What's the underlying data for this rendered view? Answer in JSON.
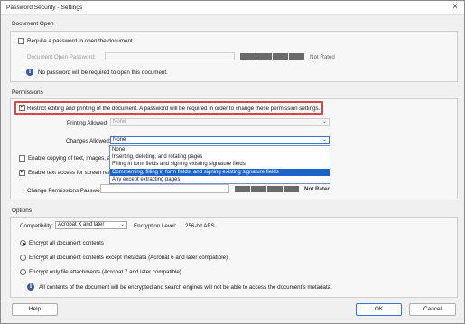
{
  "window": {
    "title": "Password Security - Settings",
    "close_glyph": "×"
  },
  "document_open": {
    "section_label": "Document Open",
    "require_password_label": "Require a password to open the document",
    "require_password_checked": false,
    "password_field_label": "Document Open Password:",
    "password_value": "",
    "strength_label": "Not Rated",
    "info_text": "No password will be required to open this document."
  },
  "permissions": {
    "section_label": "Permissions",
    "restrict_label": "Restrict editing and printing of the document. A password will be required in order to change these permission settings.",
    "restrict_checked": true,
    "printing_allowed_label": "Printing Allowed:",
    "printing_allowed_value": "None",
    "changes_allowed_label": "Changes Allowed:",
    "changes_allowed_value": "None",
    "changes_options": [
      "None",
      "Inserting, deleting, and rotating pages",
      "Filling in form fields and signing existing signature fields",
      "Commenting, filling in form fields, and signing existing signature fields",
      "Any except extracting pages"
    ],
    "changes_highlighted_option": "Commenting, filling in form fields, and signing existing signature fields",
    "enable_copying_label": "Enable copying of text, images, an",
    "enable_copying_checked": false,
    "enable_screen_reader_label": "Enable text access for screen reade",
    "enable_screen_reader_checked": true,
    "change_permissions_password_label": "Change Permissions Password:",
    "change_permissions_password_value": "",
    "strength_label": "Not Rated"
  },
  "options": {
    "section_label": "Options",
    "compatibility_label": "Compatibility:",
    "compatibility_value": "Acrobat X and later",
    "encryption_level_label": "Encryption  Level:",
    "encryption_level_value": "256-bit AES",
    "radio_options": [
      "Encrypt all document contents",
      "Encrypt all document contents except metadata (Acrobat 6 and later compatible)",
      "Encrypt only file attachments (Acrobat 7 and later compatible)"
    ],
    "selected_radio": 0,
    "info_text": "All contents of the document will be encrypted and search engines will not be able to access the document's metadata."
  },
  "buttons": {
    "help": "Help",
    "ok": "OK",
    "cancel": "Cancel"
  },
  "colors": {
    "highlight_border": "#d2494a",
    "selection_blue": "#1e64c8",
    "info_icon": "#3d5a9e"
  }
}
